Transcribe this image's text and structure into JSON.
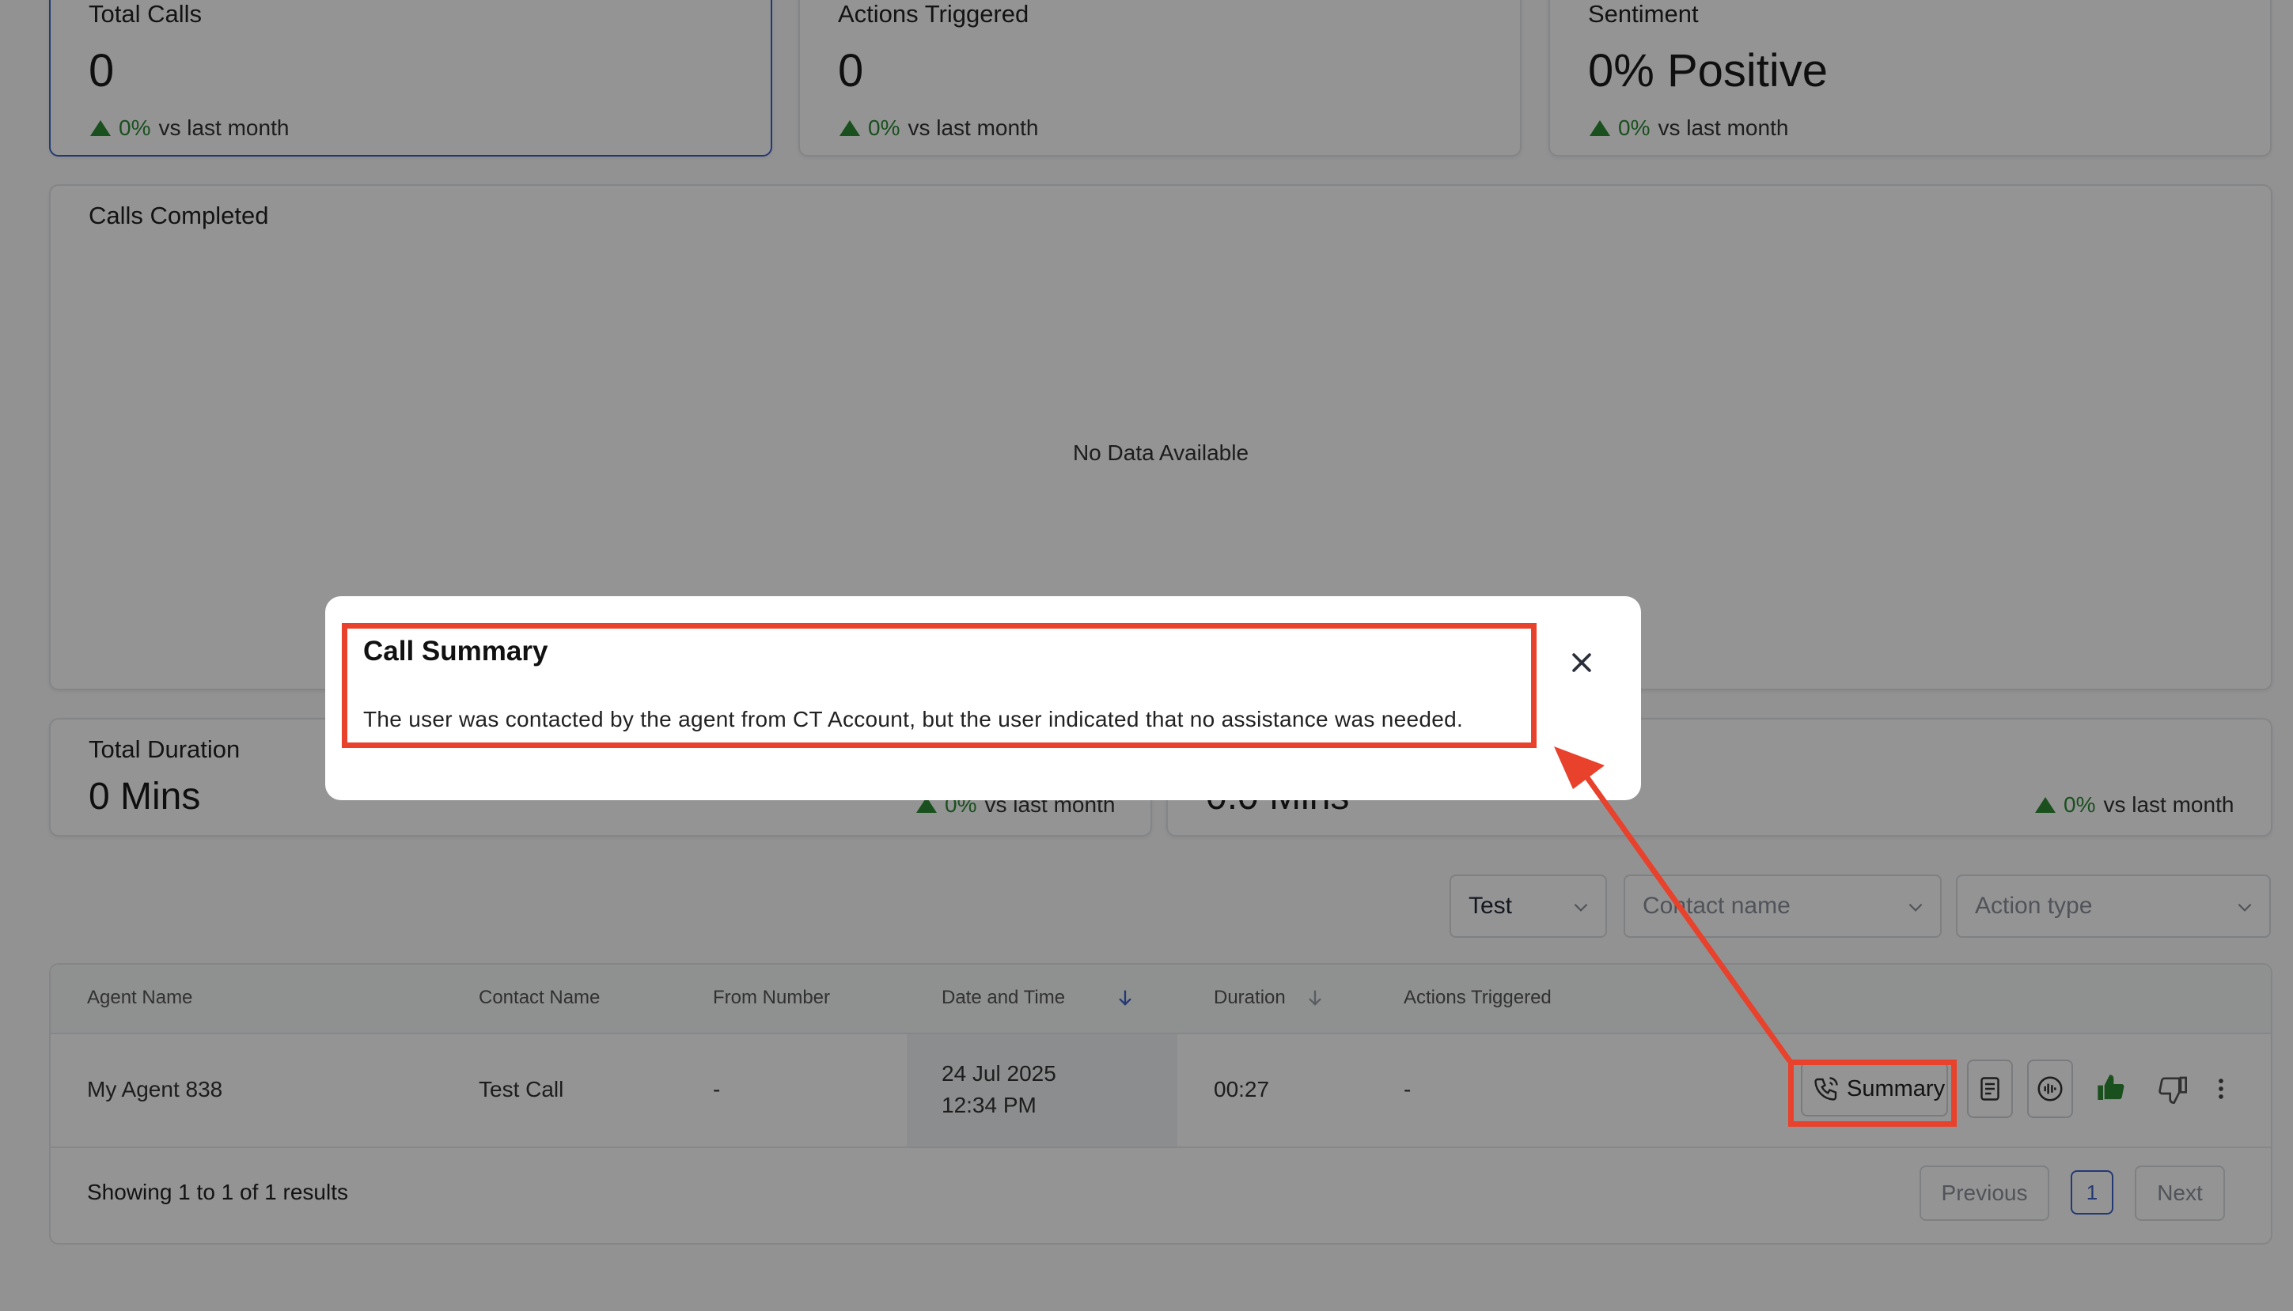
{
  "stats": {
    "total_calls": {
      "label": "Total Calls",
      "value": "0",
      "trend_pct": "0%",
      "trend_text": "vs last month"
    },
    "actions_triggered": {
      "label": "Actions Triggered",
      "value": "0",
      "trend_pct": "0%",
      "trend_text": "vs last month"
    },
    "sentiment": {
      "label": "Sentiment",
      "value": "0% Positive",
      "trend_pct": "0%",
      "trend_text": "vs last month"
    }
  },
  "calls_completed": {
    "title": "Calls Completed",
    "empty_text": "No Data Available"
  },
  "duration_row": {
    "total_duration": {
      "label": "Total Duration",
      "value": "0 Mins"
    },
    "middle_trend": {
      "pct": "0%",
      "text": "vs last month"
    },
    "second_value": "0.0 Mins",
    "right_trend": {
      "pct": "0%",
      "text": "vs last month"
    }
  },
  "filters": {
    "agent": {
      "value": "Test"
    },
    "contact": {
      "placeholder": "Contact name"
    },
    "action": {
      "placeholder": "Action type"
    }
  },
  "table": {
    "headers": [
      "Agent Name",
      "Contact Name",
      "From Number",
      "Date and Time",
      "Duration",
      "Actions Triggered"
    ],
    "rows": [
      {
        "agent": "My Agent 838",
        "contact": "Test Call",
        "from": "-",
        "date": "24 Jul 2025",
        "time": "12:34 PM",
        "duration": "00:27",
        "actions": "-",
        "summary_label": "Summary"
      }
    ]
  },
  "pagination": {
    "showing": "Showing 1 to 1 of 1 results",
    "previous": "Previous",
    "page": "1",
    "next": "Next"
  },
  "modal": {
    "title": "Call Summary",
    "text": "The user was contacted by the agent from CT Account, but the user indicated that no assistance was needed."
  },
  "colors": {
    "accent": "#3f63c9",
    "positive": "#2d8a34",
    "annotation": "#e8412c"
  },
  "icons": [
    "chevron-down-icon",
    "phone-icon",
    "transcript-icon",
    "audio-wave-icon",
    "thumbs-up-icon",
    "thumbs-down-icon",
    "more-vertical-icon",
    "sort-arrow-icon",
    "close-icon",
    "trend-up-icon"
  ]
}
